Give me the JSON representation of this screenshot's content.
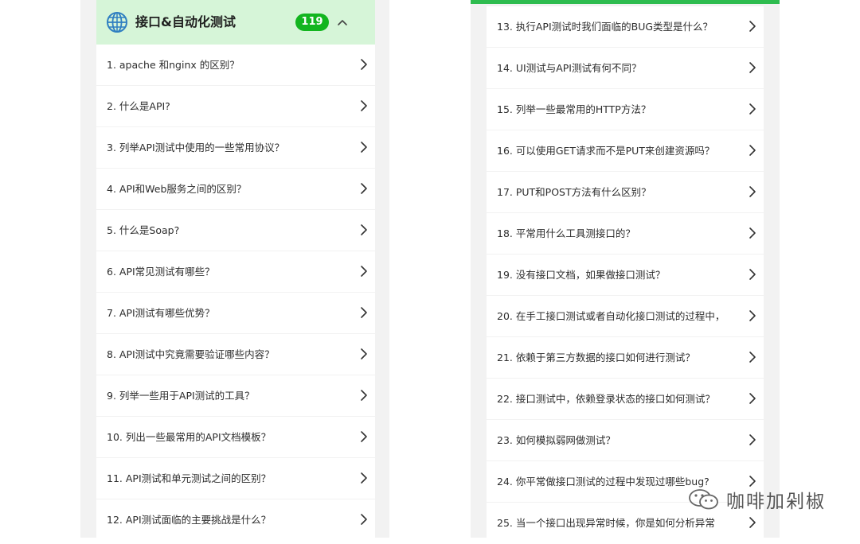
{
  "left_panel": {
    "header": {
      "title": "接口&自动化测试",
      "count": "119",
      "globe_icon": "globe-icon",
      "collapse_icon": "chevron-up-icon"
    },
    "items": [
      "1. apache 和nginx 的区别？",
      "2. 什么是API?",
      "3. 列举API测试中使用的一些常用协议？",
      "4. API和Web服务之间的区别？",
      "5. 什么是Soap?",
      "6. API常见测试有哪些？",
      "7. API测试有哪些优势？",
      "8. API测试中究竟需要验证哪些内容？",
      "9. 列举一些用于API测试的工具？",
      "10. 列出一些最常用的API文档模板？",
      "11. API测试和单元测试之间的区别？",
      "12. API测试面临的主要挑战是什么？"
    ]
  },
  "right_panel": {
    "accent_color": "#2ebc4f",
    "items": [
      "13. 执行API测试时我们面临的BUG类型是什么？",
      "14. UI测试与API测试有何不同？",
      "15. 列举一些最常用的HTTP方法？",
      "16. 可以使用GET请求而不是PUT来创建资源吗？",
      "17. PUT和POST方法有什么区别？",
      "18. 平常用什么工具测接口的？",
      "19. 没有接口文档，如果做接口测试？",
      "20. 在手工接口测试或者自动化接口测试的过程中，",
      "21. 依赖于第三方数据的接口如何进行测试？",
      "22. 接口测试中，依赖登录状态的接口如何测试？",
      "23. 如何模拟弱网做测试？",
      "24. 你平常做接口测试的过程中发现过哪些bug?",
      "25. 当一个接口出现异常时候，你是如何分析异常"
    ]
  },
  "watermark": {
    "text": "咖啡加剁椒",
    "icon": "wechat-icon"
  },
  "colors": {
    "badge": "#12b51f",
    "header_bg": "#d6f5d8",
    "panel_bg": "#f2f2f2"
  }
}
